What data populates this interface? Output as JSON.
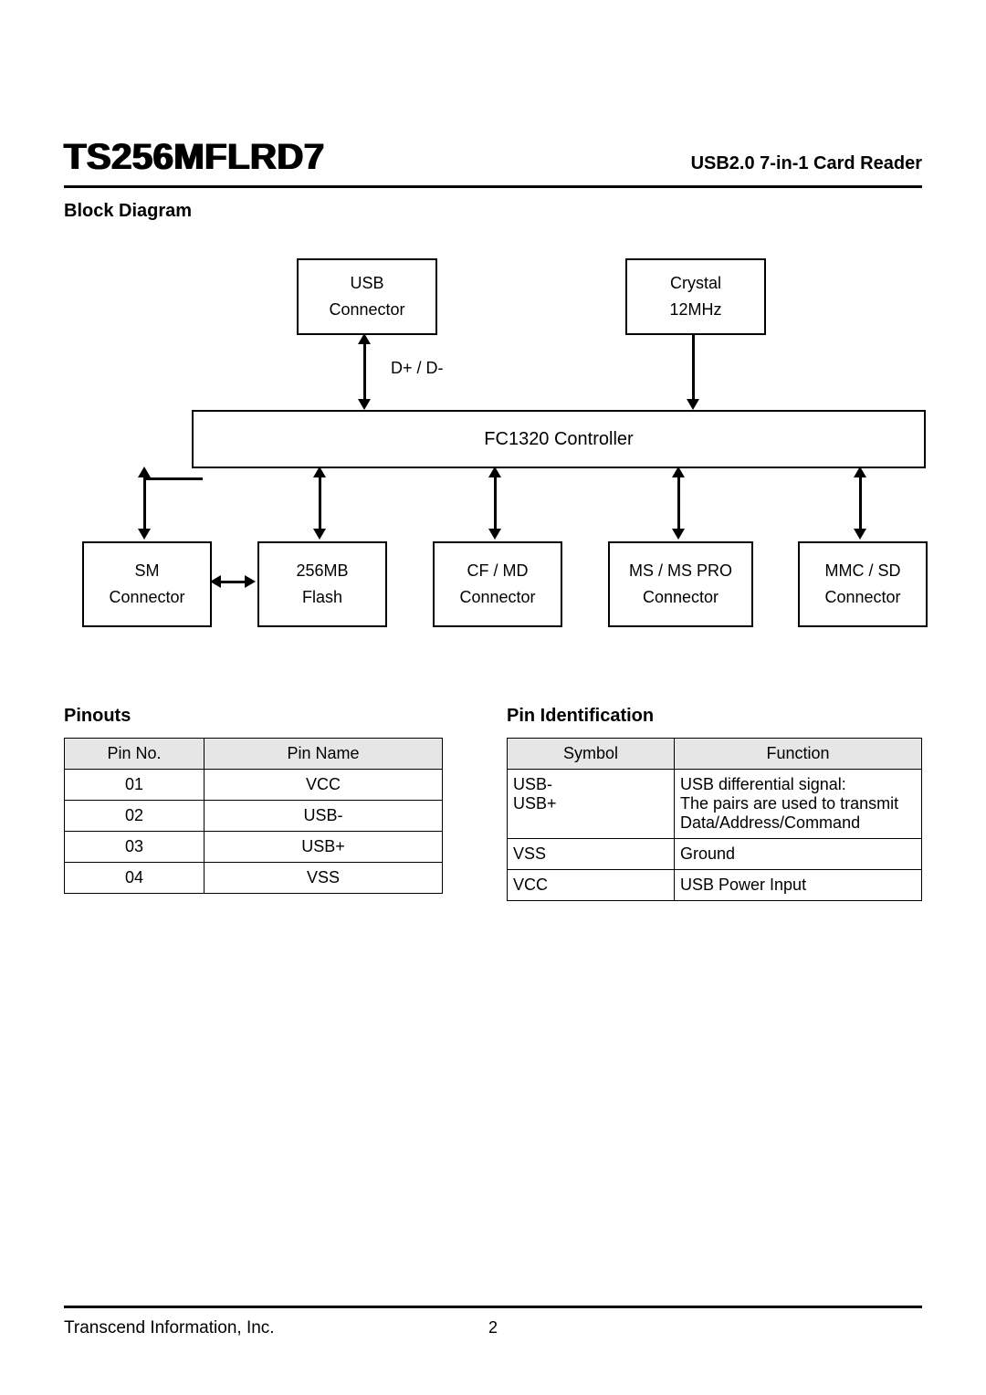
{
  "header": {
    "part_number": "TS256MFLRD7",
    "subtitle": "USB2.0 7-in-1 Card Reader"
  },
  "sections": {
    "block_diagram": "Block Diagram",
    "pinouts": "Pinouts",
    "pin_identification": "Pin Identification"
  },
  "diagram": {
    "usb_connector_line1": "USB",
    "usb_connector_line2": "Connector",
    "crystal_line1": "Crystal",
    "crystal_line2": "12MHz",
    "dplus_dminus": "D+ / D-",
    "controller": "FC1320 Controller",
    "sm_line1": "SM",
    "sm_line2": "Connector",
    "flash_line1": "256MB",
    "flash_line2": "Flash",
    "cf_line1": "CF / MD",
    "cf_line2": "Connector",
    "ms_line1": "MS / MS PRO",
    "ms_line2": "Connector",
    "mmc_line1": "MMC / SD",
    "mmc_line2": "Connector"
  },
  "pinouts_table": {
    "headers": {
      "col1": "Pin No.",
      "col2": "Pin Name"
    },
    "rows": [
      {
        "no": "01",
        "name": "VCC"
      },
      {
        "no": "02",
        "name": "USB-"
      },
      {
        "no": "03",
        "name": "USB+"
      },
      {
        "no": "04",
        "name": "VSS"
      }
    ]
  },
  "pinid_table": {
    "headers": {
      "col1": "Symbol",
      "col2": "Function"
    },
    "rows": [
      {
        "symbol_lines": [
          "USB-",
          "USB+"
        ],
        "function_lines": [
          "USB differential signal:",
          "The pairs are used to transmit",
          "Data/Address/Command"
        ]
      },
      {
        "symbol_lines": [
          "VSS"
        ],
        "function_lines": [
          "Ground"
        ]
      },
      {
        "symbol_lines": [
          "VCC"
        ],
        "function_lines": [
          "USB Power Input"
        ]
      }
    ]
  },
  "footer": {
    "company": "Transcend Information, Inc.",
    "page": "2"
  }
}
